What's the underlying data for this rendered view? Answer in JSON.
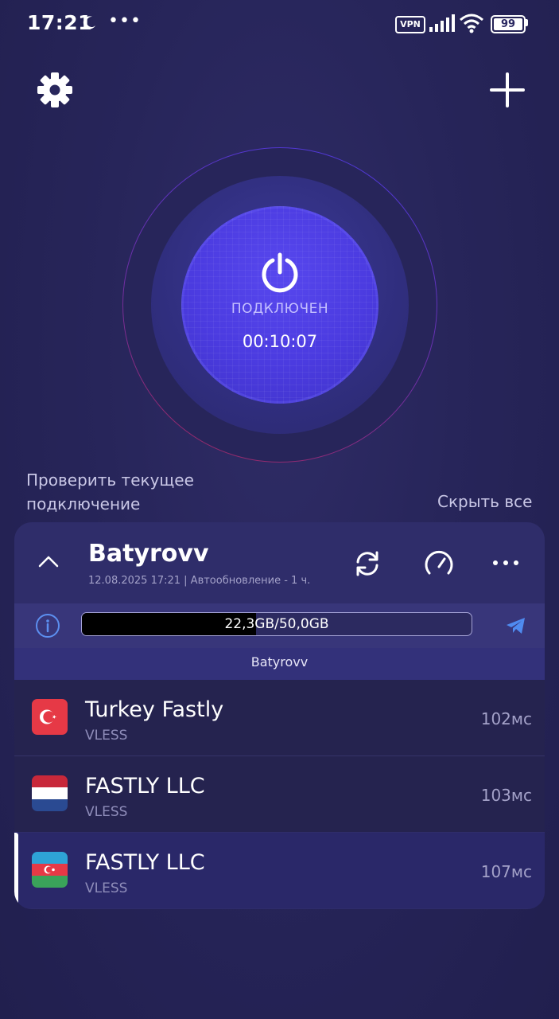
{
  "status_bar": {
    "time": "17:21",
    "vpn": "VPN",
    "battery": "99"
  },
  "header": {
    "settings_icon": "gear-icon",
    "add_icon": "plus-icon"
  },
  "connection": {
    "status": "ПОДКЛЮЧЕН",
    "timer": "00:10:07",
    "check_link": "Проверить текущее подключение",
    "hide_all": "Скрыть все"
  },
  "subscription": {
    "name": "Batyrovv",
    "meta": "12.08.2025 17:21 | Автообновление - 1 ч.",
    "usage_text": "22,3GB/50,0GB",
    "usage_fraction": 0.446,
    "group_label": "Batyrovv"
  },
  "servers": [
    {
      "name": "Turkey Fastly",
      "protocol": "VLESS",
      "ping": "102мс",
      "flag": "turkey-flag-icon",
      "selected": false
    },
    {
      "name": "FASTLY LLC",
      "protocol": "VLESS",
      "ping": "103мс",
      "flag": "netherlands-flag-icon",
      "selected": false
    },
    {
      "name": "FASTLY LLC",
      "protocol": "VLESS",
      "ping": "107мс",
      "flag": "azerbaijan-flag-icon",
      "selected": true
    }
  ],
  "colors": {
    "background": "#27255a",
    "accent": "#4b3be0",
    "card": "#2f2d6a",
    "telegram": "#4f8bf0"
  }
}
